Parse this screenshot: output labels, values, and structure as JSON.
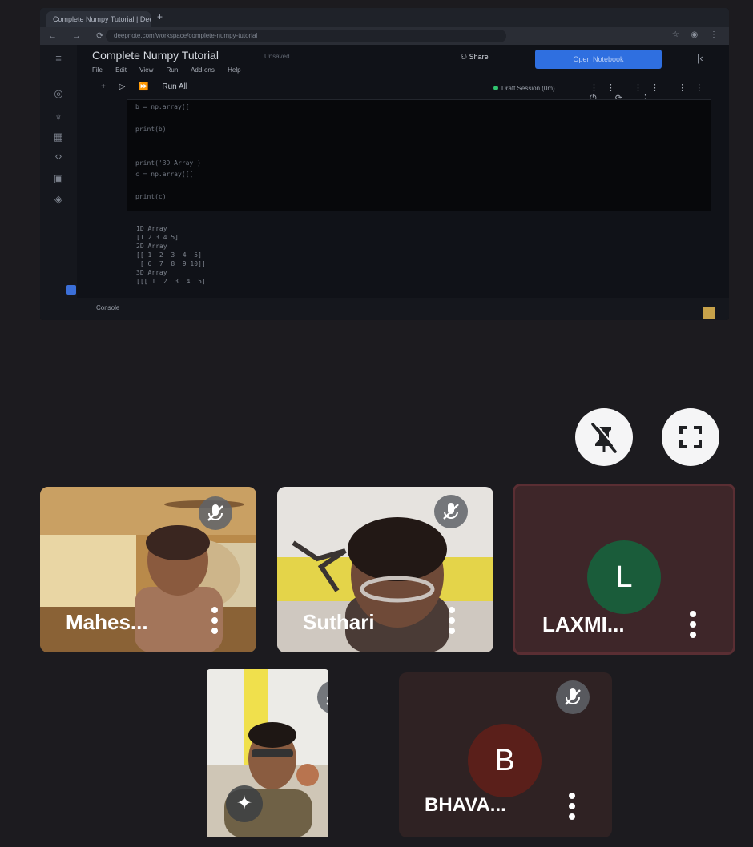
{
  "shared_screen": {
    "browser_tab": "Complete Numpy Tutorial | Deepnote",
    "url": "deepnote.com/workspace/complete-numpy-tutorial",
    "notebook_title": "Complete Numpy Tutorial",
    "saved_status": "Unsaved",
    "menu": [
      "File",
      "Edit",
      "View",
      "Run",
      "Add-ons",
      "Help"
    ],
    "share_label": "Share",
    "open_button_label": "Open Notebook",
    "toolbar": {
      "add": "+",
      "run": "▷",
      "run_all_icon": "⏩",
      "run_all": "Run All"
    },
    "session": "Draft Session (0m)",
    "code_lines": [
      "b = np.array([",
      "",
      "print(b)",
      "",
      "",
      "print('3D Array')",
      "c = np.array([[",
      "",
      "print(c)"
    ],
    "output_lines": [
      "1D Array",
      "[1 2 3 4 5]",
      "2D Array",
      "[[ 1  2  3  4  5]",
      " [ 6  7  8  9 10]]",
      "3D Array",
      "[[[ 1  2  3  4  5]"
    ],
    "console_label": "Console"
  },
  "controls": {
    "unpin_icon": "unpin-icon",
    "fullscreen_icon": "fullscreen-icon"
  },
  "participants": [
    {
      "name": "Mahes...",
      "type": "video",
      "muted": true
    },
    {
      "name": "Suthari",
      "type": "video",
      "muted": true
    },
    {
      "name": "LAXMI...",
      "type": "avatar",
      "initial": "L",
      "avatar_color": "#1a5c3a",
      "muted": false
    },
    {
      "name": "...",
      "type": "video",
      "muted": true
    },
    {
      "name": "BHAVA...",
      "type": "avatar",
      "initial": "B",
      "avatar_color": "#5a1f1a",
      "muted": true
    }
  ]
}
